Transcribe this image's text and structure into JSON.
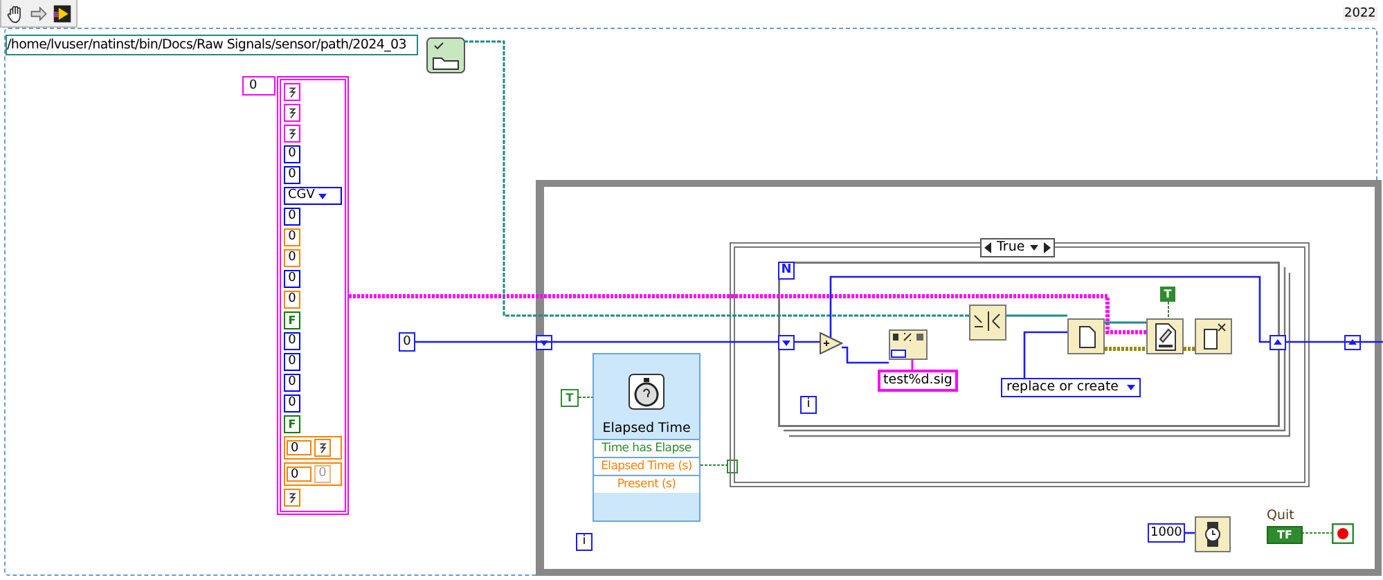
{
  "frame_label": "2022",
  "path_constant": "/home/lvuser/natinst/bin/Docs/Raw Signals/sensor/path/2024_03",
  "array_index": "0",
  "cluster_items": [
    {
      "kind": "glyph",
      "color": "#ff00ff"
    },
    {
      "kind": "glyph",
      "color": "#ff00ff"
    },
    {
      "kind": "glyph",
      "color": "#ff00ff"
    },
    {
      "kind": "number",
      "text": "0",
      "color": "#0000ff"
    },
    {
      "kind": "number",
      "text": "0",
      "color": "#0000ff"
    },
    {
      "kind": "enum",
      "text": "CGV",
      "color": "#0000ff"
    },
    {
      "kind": "number",
      "text": "0",
      "color": "#0000ff"
    },
    {
      "kind": "number",
      "text": "0",
      "color": "#ff8000"
    },
    {
      "kind": "number",
      "text": "0",
      "color": "#ff8000"
    },
    {
      "kind": "number",
      "text": "0",
      "color": "#0000ff"
    },
    {
      "kind": "number",
      "text": "0",
      "color": "#ff8000"
    },
    {
      "kind": "boolean",
      "text": "F",
      "color": "#008000"
    },
    {
      "kind": "number",
      "text": "0",
      "color": "#0000ff"
    },
    {
      "kind": "number",
      "text": "0",
      "color": "#0000ff"
    },
    {
      "kind": "number",
      "text": "0",
      "color": "#0000ff"
    },
    {
      "kind": "number",
      "text": "0",
      "color": "#0000ff"
    },
    {
      "kind": "boolean",
      "text": "F",
      "color": "#008000"
    },
    {
      "kind": "array",
      "text": "0",
      "element": {
        "kind": "glyph"
      },
      "color": "#ff8000"
    },
    {
      "kind": "array",
      "text": "0",
      "element": {
        "kind": "number",
        "text": "0"
      },
      "color": "#ff8000"
    },
    {
      "kind": "glyph",
      "color": "#ff8000"
    }
  ],
  "numeric_constant": "0",
  "true_constant": "T",
  "elapsed_time": {
    "title": "Elapsed Time",
    "outputs": [
      {
        "label": "Time has Elapse",
        "color": "#2e8b2e"
      },
      {
        "label": "Elapsed Time (s)",
        "color": "#ff8000"
      },
      {
        "label": "Present (s)",
        "color": "#ff8000"
      }
    ]
  },
  "while_iteration": "i",
  "case_selector": "True",
  "for_count": "N",
  "for_iteration": "i",
  "format_string": "test%d.sig",
  "open_mode": "replace or create",
  "write_constant": "T",
  "wait_ms": "1000",
  "quit": {
    "label": "Quit",
    "value": "TF"
  }
}
